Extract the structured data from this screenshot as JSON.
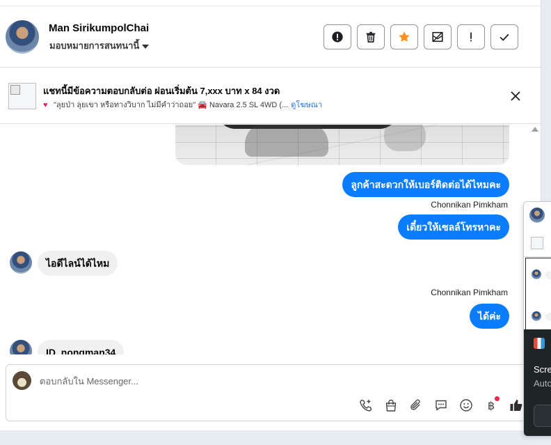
{
  "header": {
    "name": "Man SirikumpolChai",
    "subtitle": "มอบหมายการสนทนานี้",
    "actions": [
      {
        "icon": "alert-circle-icon"
      },
      {
        "icon": "trash-icon"
      },
      {
        "icon": "star-icon",
        "color": "#f7931e"
      },
      {
        "icon": "mark-unread-icon"
      },
      {
        "icon": "exclamation-icon"
      },
      {
        "icon": "check-icon"
      }
    ]
  },
  "ad": {
    "title": "แชทนี้มีข้อความตอบกลับต่อ ผ่อนเริ่มต้น 7,xxx บาท x 84 งวด",
    "description": "\"ลุยป่า ลุยเขา หรือทางวิบาก ไม่มีคำว่าถอย\" 🚘 Navara 2.5 SL 4WD (...",
    "link": "ดูโฆษณา"
  },
  "messages": [
    {
      "dir": "out",
      "text": "ลูกค้าสะดวกให้เบอร์ติดต่อได้ไหมคะ"
    },
    {
      "sender": "Chonnikan Pimkham"
    },
    {
      "dir": "out",
      "text": "เดี๋ยวให้เซลล์โทรหาคะ"
    },
    {
      "dir": "in",
      "text": "ไอดีไลน์ได้ไหม"
    },
    {
      "sender": "Chonnikan Pimkham"
    },
    {
      "dir": "out",
      "text": "ได้ค่ะ"
    },
    {
      "dir": "in",
      "text": "ID. nongman34"
    }
  ],
  "composer": {
    "placeholder": "ตอบกลับใน Messenger...",
    "tools": [
      "phone-plus-icon",
      "shopping-bag-icon",
      "paperclip-icon",
      "chat-bubble-icon",
      "emoji-icon",
      "baht-icon",
      "thumbs-up-icon"
    ],
    "baht_symbol": "฿"
  },
  "popup": {
    "line1": "Scre",
    "line2": "Auto"
  },
  "colors": {
    "accent": "#0a7cff",
    "link": "#216fdb"
  }
}
